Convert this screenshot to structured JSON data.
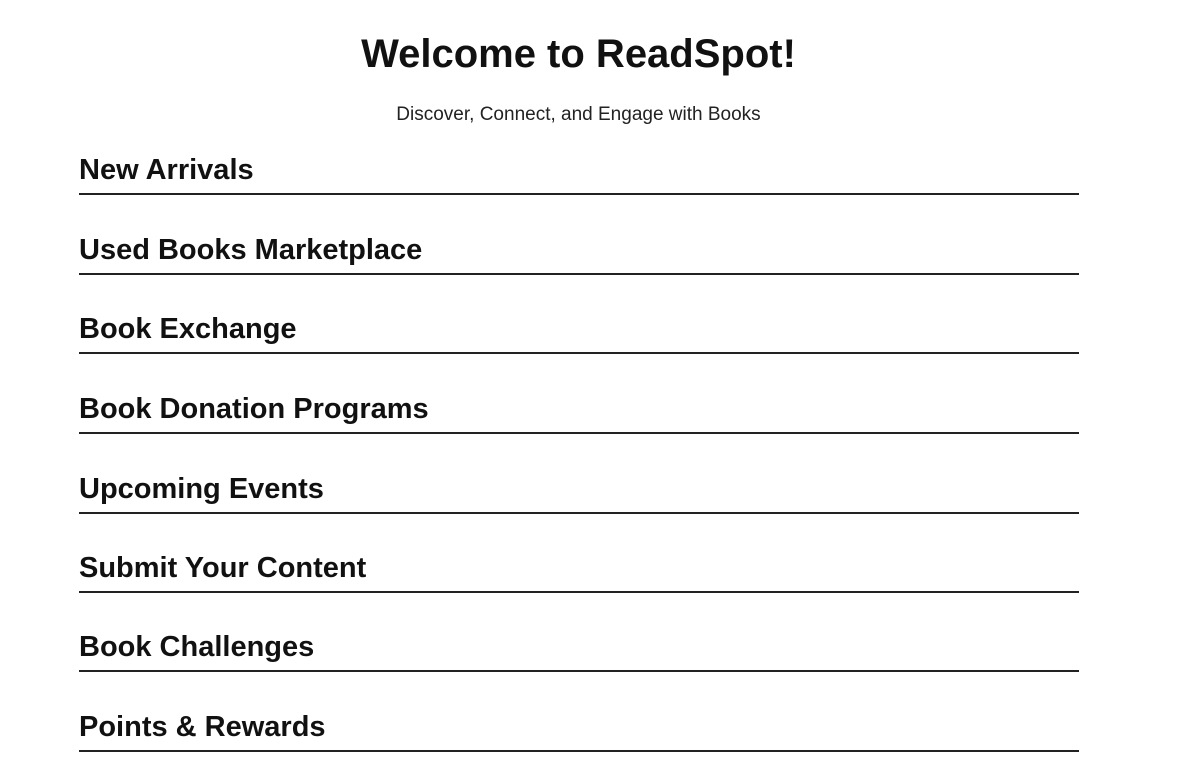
{
  "header": {
    "title": "Welcome to ReadSpot!",
    "tagline": "Discover, Connect, and Engage with Books"
  },
  "sections": [
    {
      "heading": "New Arrivals"
    },
    {
      "heading": "Used Books Marketplace"
    },
    {
      "heading": "Book Exchange"
    },
    {
      "heading": "Book Donation Programs"
    },
    {
      "heading": "Upcoming Events"
    },
    {
      "heading": "Submit Your Content"
    },
    {
      "heading": "Book Challenges"
    },
    {
      "heading": "Points & Rewards"
    }
  ]
}
